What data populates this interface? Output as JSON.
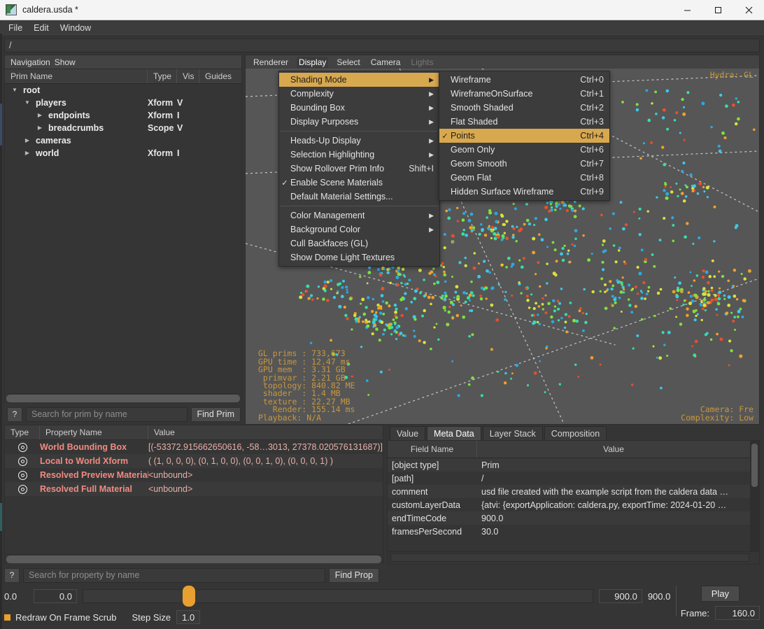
{
  "window": {
    "title": "caldera.usda *",
    "app_icon": "usd-file-icon",
    "minimize": "minimize-icon",
    "maximize": "maximize-icon",
    "close": "close-icon"
  },
  "menubar": {
    "items": [
      "File",
      "Edit",
      "Window"
    ]
  },
  "pathbar": {
    "value": "/"
  },
  "outliner": {
    "toolbar": [
      "Navigation",
      "Show"
    ],
    "columns": [
      "Prim Name",
      "Type",
      "Vis",
      "Guides"
    ],
    "rows": [
      {
        "name": "root",
        "type": "",
        "vis": "",
        "guides": "",
        "depth": 0,
        "arrow": "down",
        "bold": true
      },
      {
        "name": "players",
        "type": "Xform",
        "vis": "V",
        "guides": "",
        "depth": 1,
        "arrow": "down",
        "bold": true
      },
      {
        "name": "endpoints",
        "type": "Xform",
        "vis": "I",
        "guides": "",
        "depth": 2,
        "arrow": "right",
        "bold": true
      },
      {
        "name": "breadcrumbs",
        "type": "Scope",
        "vis": "V",
        "guides": "",
        "depth": 2,
        "arrow": "right",
        "bold": true
      },
      {
        "name": "cameras",
        "type": "",
        "vis": "",
        "guides": "",
        "depth": 1,
        "arrow": "right",
        "bold": true
      },
      {
        "name": "world",
        "type": "Xform",
        "vis": "I",
        "guides": "",
        "depth": 1,
        "arrow": "right",
        "bold": true
      }
    ],
    "search": {
      "placeholder": "Search for prim by name",
      "value": "",
      "help_label": "?"
    },
    "find_button": "Find Prim"
  },
  "viewport": {
    "toolbar": [
      {
        "label": "Renderer",
        "state": "normal"
      },
      {
        "label": "Display",
        "state": "active"
      },
      {
        "label": "Select",
        "state": "normal"
      },
      {
        "label": "Camera",
        "state": "normal"
      },
      {
        "label": "Lights",
        "state": "disabled"
      }
    ],
    "hud_top_right": "Hydra: GL",
    "hud_bottom_left": "GL prims : 733,673\nGPU time : 12.47 ms\nGPU mem  : 3.31 GB\n primvar : 2.21 GB\n topology: 840.82 ME\n shader  : 1.4 MB\n texture : 22.27 MB\n   Render: 155.14 ms\nPlayback: N/A",
    "hud_bottom_right": "Camera: Fre\nComplexity: Low",
    "background_color": "#565656",
    "point_colors": [
      "#3ec8e8",
      "#35e0a8",
      "#7ce23c",
      "#d8e23c",
      "#f0a02c",
      "#e8502c",
      "#2ca8e0"
    ]
  },
  "display_menu": {
    "items": [
      {
        "label": "Shading Mode",
        "accel": "",
        "submenu": true,
        "checked": false,
        "selected": true
      },
      {
        "label": "Complexity",
        "accel": "",
        "submenu": true,
        "checked": false,
        "selected": false
      },
      {
        "label": "Bounding Box",
        "accel": "",
        "submenu": true,
        "checked": false,
        "selected": false
      },
      {
        "label": "Display Purposes",
        "accel": "",
        "submenu": true,
        "checked": false,
        "selected": false
      },
      {
        "label": "Heads-Up Display",
        "accel": "",
        "submenu": true,
        "checked": false,
        "selected": false
      },
      {
        "label": "Selection Highlighting",
        "accel": "",
        "submenu": true,
        "checked": false,
        "selected": false
      },
      {
        "label": "Show Rollover Prim Info",
        "accel": "Shift+I",
        "submenu": false,
        "checked": false,
        "selected": false
      },
      {
        "label": "Enable Scene Materials",
        "accel": "",
        "submenu": false,
        "checked": true,
        "selected": false
      },
      {
        "label": "Default Material Settings...",
        "accel": "",
        "submenu": false,
        "checked": false,
        "selected": false
      },
      {
        "label": "Color Management",
        "accel": "",
        "submenu": true,
        "checked": false,
        "selected": false
      },
      {
        "label": "Background Color",
        "accel": "",
        "submenu": true,
        "checked": false,
        "selected": false
      },
      {
        "label": "Cull Backfaces (GL)",
        "accel": "",
        "submenu": false,
        "checked": false,
        "selected": false
      },
      {
        "label": "Show Dome Light Textures",
        "accel": "",
        "submenu": false,
        "checked": false,
        "selected": false
      }
    ],
    "separators_after": [
      3,
      8
    ]
  },
  "shading_menu": {
    "items": [
      {
        "label": "Wireframe",
        "accel": "Ctrl+0",
        "checked": false,
        "selected": false
      },
      {
        "label": "WireframeOnSurface",
        "accel": "Ctrl+1",
        "checked": false,
        "selected": false
      },
      {
        "label": "Smooth Shaded",
        "accel": "Ctrl+2",
        "checked": false,
        "selected": false
      },
      {
        "label": "Flat Shaded",
        "accel": "Ctrl+3",
        "checked": false,
        "selected": false
      },
      {
        "label": "Points",
        "accel": "Ctrl+4",
        "checked": true,
        "selected": true
      },
      {
        "label": "Geom Only",
        "accel": "Ctrl+6",
        "checked": false,
        "selected": false
      },
      {
        "label": "Geom Smooth",
        "accel": "Ctrl+7",
        "checked": false,
        "selected": false
      },
      {
        "label": "Geom Flat",
        "accel": "Ctrl+8",
        "checked": false,
        "selected": false
      },
      {
        "label": "Hidden Surface Wireframe",
        "accel": "Ctrl+9",
        "checked": false,
        "selected": false
      }
    ]
  },
  "properties": {
    "columns": [
      "Type",
      "Property Name",
      "Value"
    ],
    "rows": [
      {
        "icon": "attribute-icon",
        "name": "World Bounding Box",
        "value": "[(-53372.915662650616, -58…3013, 27378.020576131687)]"
      },
      {
        "icon": "attribute-icon",
        "name": "Local to World Xform",
        "value": "( (1, 0, 0, 0), (0, 1, 0, 0), (0, 0, 1, 0), (0, 0, 0, 1) )"
      },
      {
        "icon": "attribute-icon",
        "name": "Resolved Preview Material",
        "value": "<unbound>"
      },
      {
        "icon": "attribute-icon",
        "name": "Resolved Full Material",
        "value": "<unbound>"
      }
    ],
    "search": {
      "placeholder": "Search for property by name",
      "value": "",
      "help_label": "?"
    },
    "find_button": "Find Prop"
  },
  "inspector": {
    "tabs": [
      {
        "label": "Value",
        "active": false
      },
      {
        "label": "Meta Data",
        "active": true
      },
      {
        "label": "Layer Stack",
        "active": false
      },
      {
        "label": "Composition",
        "active": false
      }
    ],
    "columns": [
      "Field Name",
      "Value"
    ],
    "rows": [
      {
        "field": "[object type]",
        "value": "Prim"
      },
      {
        "field": "[path]",
        "value": "/"
      },
      {
        "field": "comment",
        "value": "usd file created with the example script from the caldera data …"
      },
      {
        "field": "customLayerData",
        "value": "{atvi: {exportApplication: caldera.py, exportTime: 2024-01-20 …"
      },
      {
        "field": "endTimeCode",
        "value": "900.0"
      },
      {
        "field": "framesPerSecond",
        "value": "30.0"
      }
    ]
  },
  "timeline": {
    "start_label": "0.0",
    "start_field": "0.0",
    "end_field": "900.0",
    "end_label": "900.0",
    "play_button": "Play",
    "redraw_label": "Redraw On Frame Scrub",
    "redraw_checked": true,
    "step_size_label": "Step Size",
    "step_size_value": "1.0",
    "frame_label": "Frame:",
    "frame_value": "160.0",
    "accent_color": "#e8a030"
  }
}
